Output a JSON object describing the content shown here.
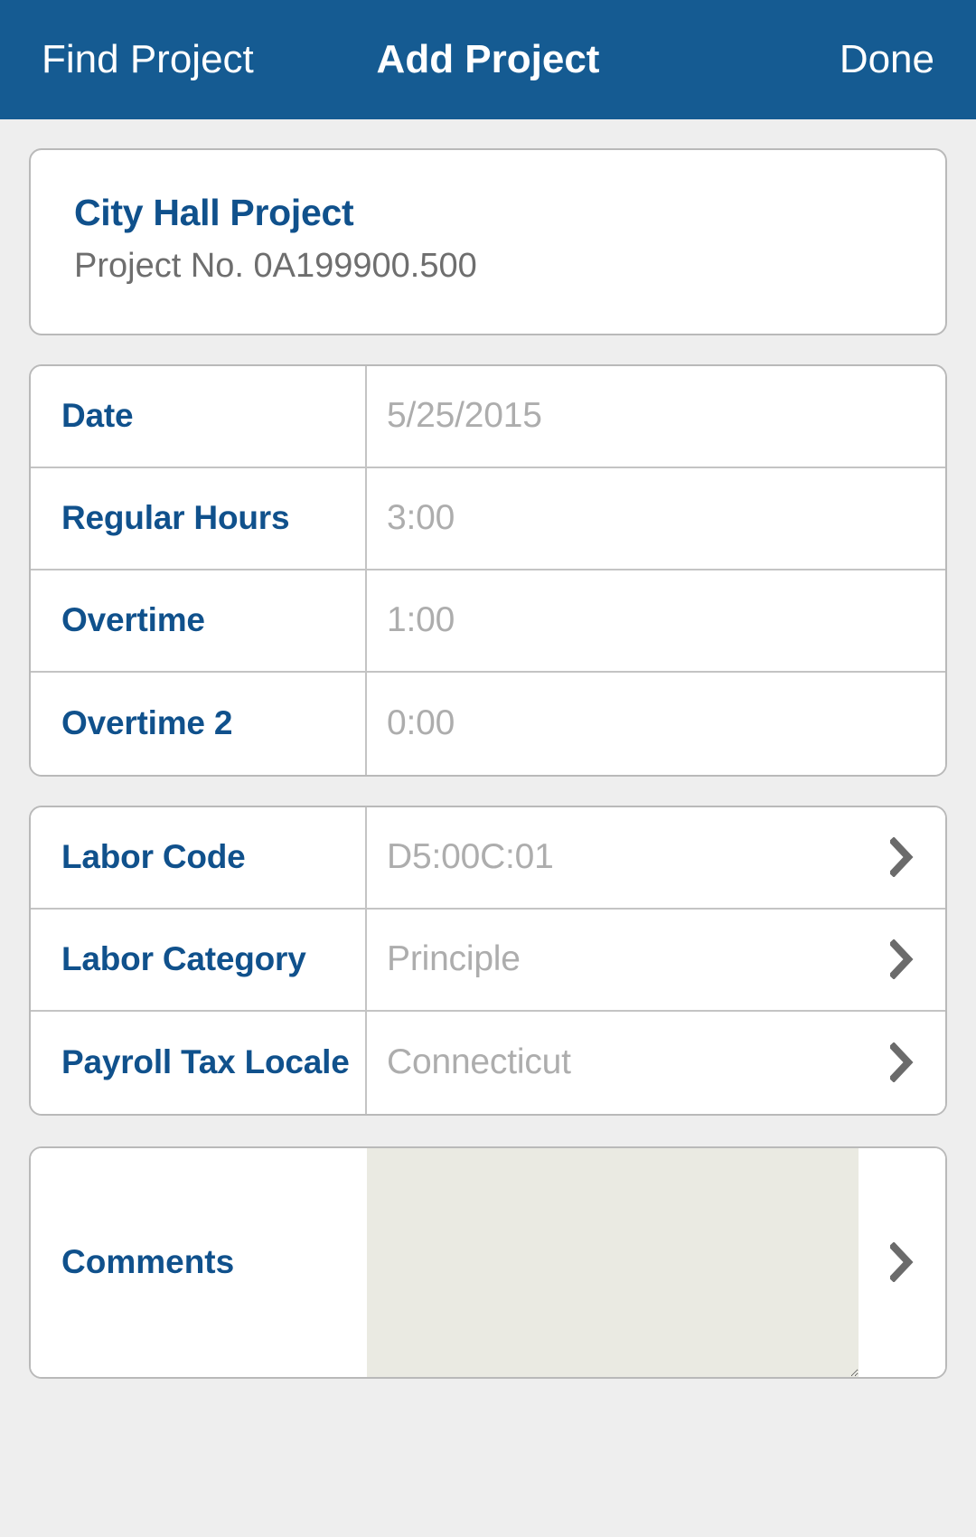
{
  "navbar": {
    "left_label": "Find Project",
    "title": "Add Project",
    "right_label": "Done",
    "background_color": "#155b92",
    "text_color": "#ffffff"
  },
  "project": {
    "name": "City Hall Project",
    "number_line": "Project No. 0A199900.500"
  },
  "time_section": {
    "rows": [
      {
        "label": "Date",
        "value": "5/25/2015"
      },
      {
        "label": "Regular Hours",
        "value": "3:00"
      },
      {
        "label": "Overtime",
        "value": "1:00"
      },
      {
        "label": "Overtime 2",
        "value": "0:00"
      }
    ]
  },
  "codes_section": {
    "rows": [
      {
        "label": "Labor Code",
        "value": "D5:00C:01",
        "icon": "chevron-right-icon"
      },
      {
        "label": "Labor Category",
        "value": "Principle",
        "icon": "chevron-right-icon"
      },
      {
        "label": "Payroll Tax Locale",
        "value": "Connecticut",
        "icon": "chevron-right-icon"
      }
    ]
  },
  "comments_section": {
    "label": "Comments",
    "value": "",
    "placeholder": "",
    "icon": "chevron-right-icon"
  },
  "colors": {
    "accent_blue": "#155b92",
    "label_blue": "#10518c",
    "value_gray": "#adadad",
    "page_background": "#eeeeee",
    "card_border": "#b9b9b9",
    "textarea_background": "#eaeae2"
  }
}
